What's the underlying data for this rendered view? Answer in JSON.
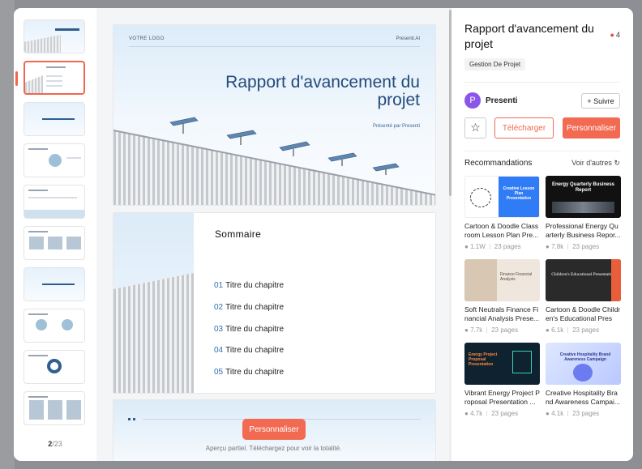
{
  "thumbnails": {
    "count": 10,
    "active_index": 1
  },
  "pager": {
    "current": "2",
    "total": "/23"
  },
  "slides": {
    "cover": {
      "logo": "VOTRE LOGO",
      "brand": "Presenti.AI",
      "title": "Rapport d'avancement du projet",
      "subtitle": "Présenté par Presenti"
    },
    "summary": {
      "heading": "Sommaire",
      "items": [
        {
          "num": "01",
          "label": "Titre du chapitre"
        },
        {
          "num": "02",
          "label": "Titre du chapitre"
        },
        {
          "num": "03",
          "label": "Titre du chapitre"
        },
        {
          "num": "04",
          "label": "Titre du chapitre"
        },
        {
          "num": "05",
          "label": "Titre du chapitre"
        }
      ]
    }
  },
  "preview": {
    "cta_label": "Personnaliser",
    "note": "Aperçu partiel. Téléchargez pour voir la totalité."
  },
  "panel": {
    "title": "Rapport d'avancement du projet",
    "likes": "4",
    "tag": "Gestion De Projet",
    "author": {
      "initial": "P",
      "name": "Presenti"
    },
    "follow_label": "+ Suivre",
    "download_label": "Télécharger",
    "customize_label": "Personnaliser",
    "recommendations_heading": "Recommandations",
    "see_more": "Voir d'autres",
    "accent": "#f26a52"
  },
  "recommendations": [
    {
      "caption": "Cartoon & Doodle Class room Lesson Plan Pre...",
      "views": "1.1W",
      "pages": "23 pages",
      "image_text": "Creative Lesson Plan Presentation"
    },
    {
      "caption": "Professional Energy Qu arterly Business Repor...",
      "views": "7.8k",
      "pages": "23 pages",
      "image_text": "Energy Quarterly Business Report"
    },
    {
      "caption": "Soft Neutrals Finance Fi nancial Analysis Prese...",
      "views": "7.7k",
      "pages": "23 pages",
      "image_text": "Finance Financial Analysis"
    },
    {
      "caption": "Cartoon & Doodle Childr en's Educational Prese...",
      "views": "6.1k",
      "pages": "23 pages",
      "image_text": "Children's Educational Presentation"
    },
    {
      "caption": "Vibrant Energy Project Proposal Presentation ...",
      "views": "4.7k",
      "pages": "23 pages",
      "image_text": "Energy Project Proposal Presentation"
    },
    {
      "caption": "Creative Hospitality Bra nd Awareness Campai...",
      "views": "4.1k",
      "pages": "23 pages",
      "image_text": "Creative Hospitality Brand Awareness Campaign"
    }
  ]
}
